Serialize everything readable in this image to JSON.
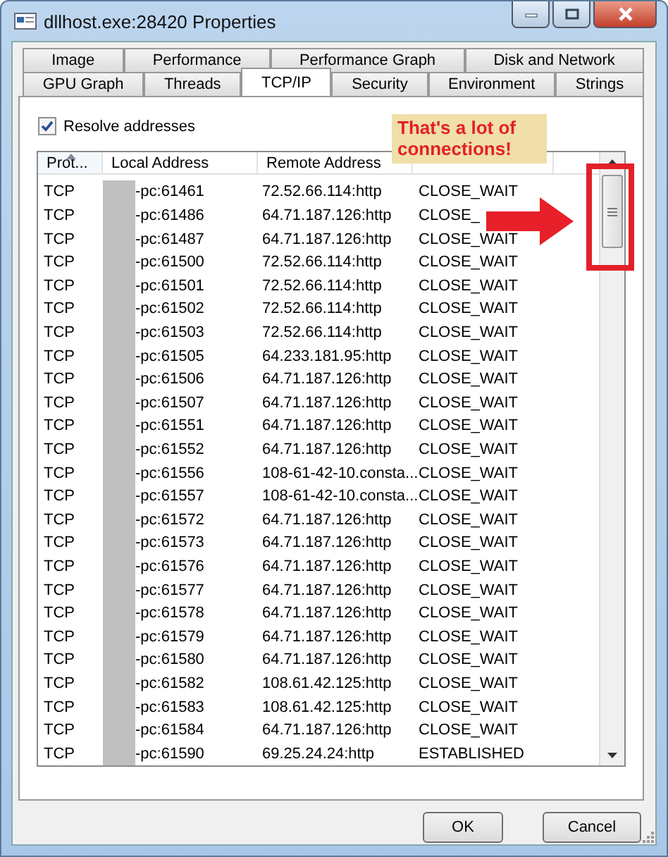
{
  "window": {
    "title": "dllhost.exe:28420 Properties"
  },
  "tab_rows": [
    [
      {
        "label": "Image",
        "selected": false
      },
      {
        "label": "Performance",
        "selected": false
      },
      {
        "label": "Performance Graph",
        "selected": false
      },
      {
        "label": "Disk and Network",
        "selected": false
      }
    ],
    [
      {
        "label": "GPU Graph",
        "selected": false
      },
      {
        "label": "Threads",
        "selected": false
      },
      {
        "label": "TCP/IP",
        "selected": true
      },
      {
        "label": "Security",
        "selected": false
      },
      {
        "label": "Environment",
        "selected": false
      },
      {
        "label": "Strings",
        "selected": false
      }
    ]
  ],
  "resolve_addresses": {
    "label": "Resolve addresses",
    "checked": true
  },
  "table": {
    "columns": [
      "Prot...",
      "Local Address",
      "Remote Address"
    ],
    "local_host_redacted": true,
    "rows": [
      [
        "TCP",
        "-pc:61461",
        "72.52.66.114:http",
        "CLOSE_WAIT"
      ],
      [
        "TCP",
        "-pc:61486",
        "64.71.187.126:http",
        "CLOSE_"
      ],
      [
        "TCP",
        "-pc:61487",
        "64.71.187.126:http",
        "CLOSE_WAIT"
      ],
      [
        "TCP",
        "-pc:61500",
        "72.52.66.114:http",
        "CLOSE_WAIT"
      ],
      [
        "TCP",
        "-pc:61501",
        "72.52.66.114:http",
        "CLOSE_WAIT"
      ],
      [
        "TCP",
        "-pc:61502",
        "72.52.66.114:http",
        "CLOSE_WAIT"
      ],
      [
        "TCP",
        "-pc:61503",
        "72.52.66.114:http",
        "CLOSE_WAIT"
      ],
      [
        "TCP",
        "-pc:61505",
        "64.233.181.95:http",
        "CLOSE_WAIT"
      ],
      [
        "TCP",
        "-pc:61506",
        "64.71.187.126:http",
        "CLOSE_WAIT"
      ],
      [
        "TCP",
        "-pc:61507",
        "64.71.187.126:http",
        "CLOSE_WAIT"
      ],
      [
        "TCP",
        "-pc:61551",
        "64.71.187.126:http",
        "CLOSE_WAIT"
      ],
      [
        "TCP",
        "-pc:61552",
        "64.71.187.126:http",
        "CLOSE_WAIT"
      ],
      [
        "TCP",
        "-pc:61556",
        "108-61-42-10.consta...",
        "CLOSE_WAIT"
      ],
      [
        "TCP",
        "-pc:61557",
        "108-61-42-10.consta...",
        "CLOSE_WAIT"
      ],
      [
        "TCP",
        "-pc:61572",
        "64.71.187.126:http",
        "CLOSE_WAIT"
      ],
      [
        "TCP",
        "-pc:61573",
        "64.71.187.126:http",
        "CLOSE_WAIT"
      ],
      [
        "TCP",
        "-pc:61576",
        "64.71.187.126:http",
        "CLOSE_WAIT"
      ],
      [
        "TCP",
        "-pc:61577",
        "64.71.187.126:http",
        "CLOSE_WAIT"
      ],
      [
        "TCP",
        "-pc:61578",
        "64.71.187.126:http",
        "CLOSE_WAIT"
      ],
      [
        "TCP",
        "-pc:61579",
        "64.71.187.126:http",
        "CLOSE_WAIT"
      ],
      [
        "TCP",
        "-pc:61580",
        "64.71.187.126:http",
        "CLOSE_WAIT"
      ],
      [
        "TCP",
        "-pc:61582",
        "108.61.42.125:http",
        "CLOSE_WAIT"
      ],
      [
        "TCP",
        "-pc:61583",
        "108.61.42.125:http",
        "CLOSE_WAIT"
      ],
      [
        "TCP",
        "-pc:61584",
        "64.71.187.126:http",
        "CLOSE_WAIT"
      ],
      [
        "TCP",
        "-pc:61590",
        "69.25.24.24:http",
        "ESTABLISHED"
      ]
    ]
  },
  "annotation": {
    "text": "That's a lot of connections!"
  },
  "buttons": [
    "OK",
    "Cancel"
  ]
}
